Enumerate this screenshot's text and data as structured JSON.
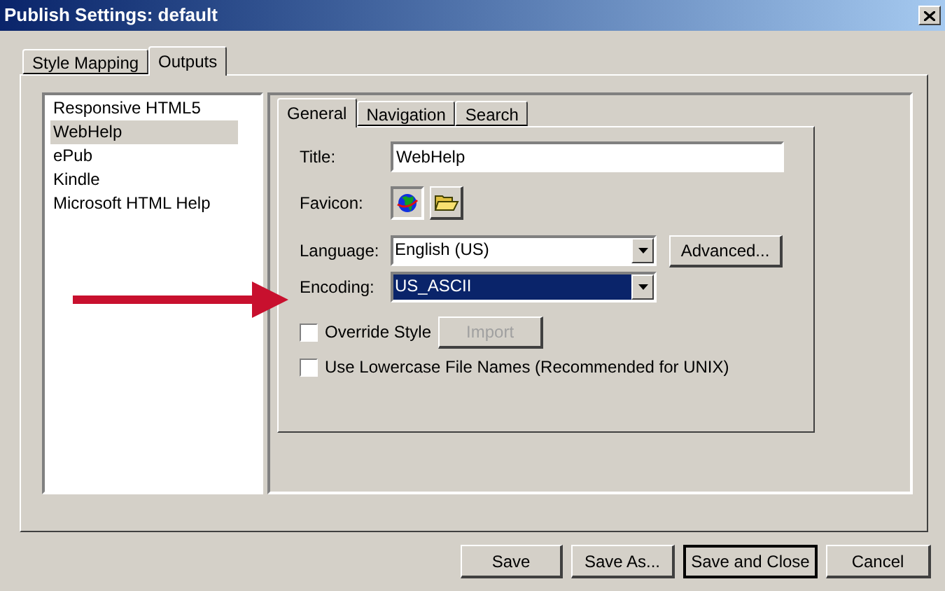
{
  "window": {
    "title": "Publish Settings: default"
  },
  "tabs": [
    {
      "label": "Style Mapping",
      "selected": false
    },
    {
      "label": "Outputs",
      "selected": true
    }
  ],
  "outputs": [
    {
      "label": "Responsive HTML5",
      "selected": false
    },
    {
      "label": "WebHelp",
      "selected": true
    },
    {
      "label": "ePub",
      "selected": false
    },
    {
      "label": "Kindle",
      "selected": false
    },
    {
      "label": "Microsoft HTML Help",
      "selected": false
    }
  ],
  "inner_tabs": [
    {
      "label": "General",
      "selected": true
    },
    {
      "label": "Navigation",
      "selected": false
    },
    {
      "label": "Search",
      "selected": false
    }
  ],
  "title_field": {
    "label": "Title:",
    "value": "WebHelp"
  },
  "favicon": {
    "label": "Favicon:"
  },
  "language": {
    "label": "Language:",
    "value": "English (US)",
    "button": "Advanced..."
  },
  "encoding": {
    "label": "Encoding:",
    "value": "US_ASCII"
  },
  "override_style": {
    "label": "Override Style",
    "checked": false,
    "button": "Import",
    "disabled": true
  },
  "lowercase_names": {
    "label": "Use Lowercase File Names (Recommended for UNIX)",
    "checked": false
  },
  "buttons": [
    {
      "label": "Save",
      "default": false
    },
    {
      "label": "Save As...",
      "default": false
    },
    {
      "label": "Save and Close",
      "default": true
    },
    {
      "label": "Cancel",
      "default": false
    }
  ]
}
